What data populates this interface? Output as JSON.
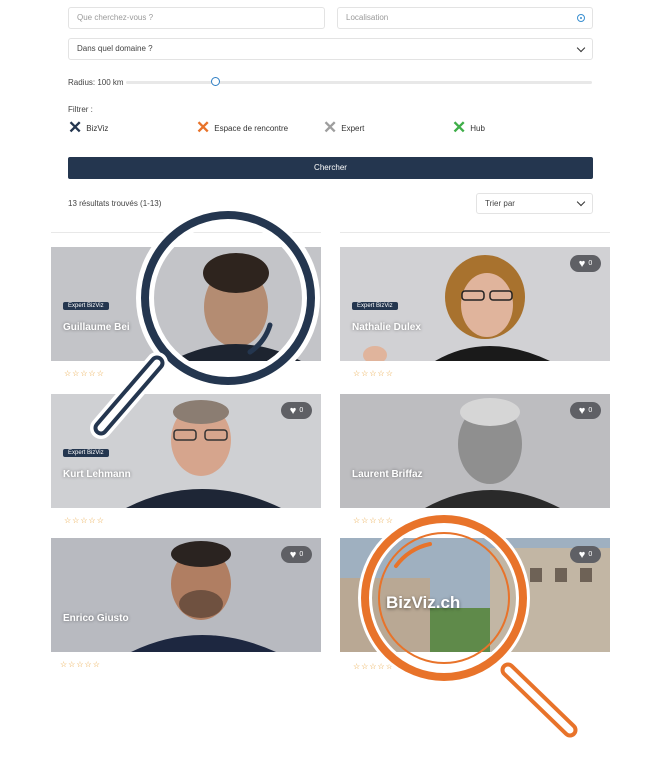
{
  "search": {
    "query_placeholder": "Que cherchez-vous ?",
    "location_placeholder": "Localisation",
    "domain_select": "Dans quel domaine ?",
    "radius_label": "Radius: 100 km",
    "radius_value_fraction": 0.19
  },
  "filters": {
    "label": "Filtrer :",
    "items": [
      {
        "label": "BizViz",
        "color": "#24364f"
      },
      {
        "label": "Espace de rencontre",
        "color": "#e8732a"
      },
      {
        "label": "Expert",
        "color": "#9e9e9e"
      },
      {
        "label": "Hub",
        "color": "#3fae49"
      }
    ]
  },
  "search_button": "Chercher",
  "results": {
    "count_text": "13 résultats trouvés (1-13)",
    "sort_label": "Trier par"
  },
  "cards": [
    {
      "name": "Guillaume Bei",
      "badge": "Expert BizViz",
      "favorites": "",
      "rating": "☆☆☆☆☆"
    },
    {
      "name": "Nathalie Dulex",
      "badge": "Expert BizViz",
      "favorites": "0",
      "rating": "☆☆☆☆☆"
    },
    {
      "name": "Kurt Lehmann",
      "badge": "Expert BizViz",
      "favorites": "0",
      "rating": "☆☆☆☆☆"
    },
    {
      "name": "Laurent Briffaz",
      "badge": "",
      "favorites": "0",
      "rating": "☆☆☆☆☆"
    },
    {
      "name": "Enrico Giusto",
      "badge": "",
      "favorites": "0",
      "rating": "☆☆☆☆☆"
    },
    {
      "name": "",
      "badge": "",
      "favorites": "0",
      "rating": "☆☆☆☆☆"
    }
  ],
  "overlay": {
    "logo_text": "BizViz.ch",
    "left_magnifier_color": "#24364f",
    "right_magnifier_color": "#e8732a"
  },
  "icons": {
    "location": "location-target-icon",
    "dropdown": "chevron-down-icon",
    "favorite": "heart-icon",
    "filter_mark": "x-mark-icon",
    "magnifier": "magnifying-glass-icon"
  }
}
